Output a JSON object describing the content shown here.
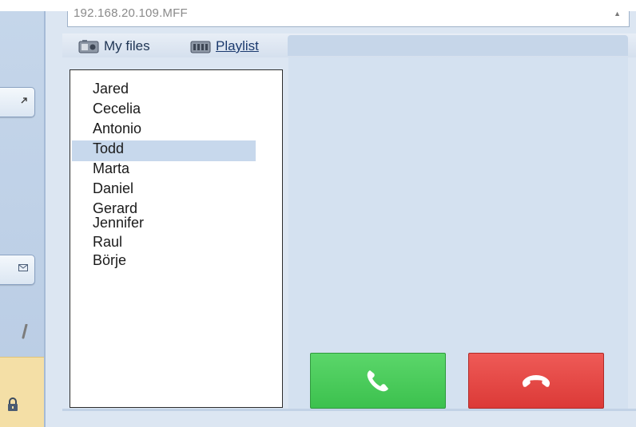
{
  "address": {
    "value": "192.168.20.109.MFF",
    "arrow_icon": "dropdown-arrow-icon"
  },
  "tabs": [
    {
      "label": "My files",
      "icon": "my-files-icon",
      "active": true
    },
    {
      "label": "Playlist",
      "icon": "playlist-icon",
      "active": false
    }
  ],
  "contacts": {
    "items": [
      "Jared",
      "Cecelia",
      "Antonio",
      "Todd",
      "Marta",
      "Daniel",
      "Gerard",
      "Jennifer",
      "Raul",
      "Börje"
    ],
    "selected_index": 3
  },
  "call_buttons": {
    "answer": {
      "icon": "phone-answer-icon",
      "color": "#44c453"
    },
    "hangup": {
      "icon": "phone-hangup-icon",
      "color": "#e2413e"
    }
  },
  "sidebar": {
    "icons": [
      "arrow-icon",
      "envelope-icon",
      "pen-icon",
      "lock-icon"
    ]
  },
  "colors": {
    "panel_bg": "#dce6f2",
    "selection": "#c7d8ec",
    "lock_tile": "#f4dfa6"
  }
}
